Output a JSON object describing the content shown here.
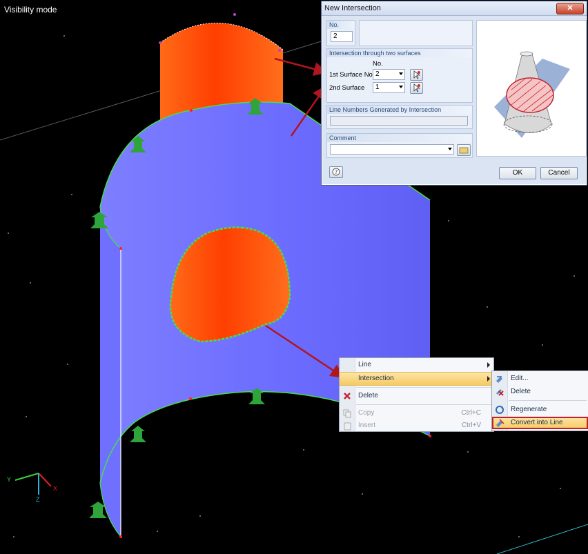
{
  "viewport": {
    "mode_label": "Visibility mode",
    "axis_labels": {
      "y": "Y",
      "x": "X",
      "z": "Z"
    }
  },
  "dialog": {
    "title": "New Intersection",
    "close_label": "✕",
    "no_label": "No.",
    "no_value": "2",
    "section_surfaces": "Intersection through two surfaces",
    "col_no": "No.",
    "first_surface_label": "1st Surface No.:",
    "first_surface_value": "2",
    "second_surface_label": "2nd Surface",
    "second_surface_value": "1",
    "section_lines": "Line Numbers Generated by Intersection",
    "section_comment": "Comment",
    "ok_label": "OK",
    "cancel_label": "Cancel"
  },
  "context_menu": {
    "items": [
      {
        "label": "Line",
        "has_submenu": true
      },
      {
        "label": "Intersection",
        "has_submenu": true,
        "highlighted": true
      },
      {
        "label": "Delete",
        "icon": "delete-icon"
      },
      {
        "label": "Copy",
        "shortcut": "Ctrl+C",
        "disabled": true
      },
      {
        "label": "Insert",
        "shortcut": "Ctrl+V",
        "disabled": true
      }
    ]
  },
  "submenu": {
    "items": [
      {
        "label": "Edit...",
        "icon": "edit-icon"
      },
      {
        "label": "Delete",
        "icon": "delete-icon"
      },
      {
        "label": "Regenerate",
        "icon": "regenerate-icon"
      },
      {
        "label": "Convert into Line",
        "icon": "convert-icon",
        "highlighted": true
      }
    ]
  },
  "colors": {
    "background": "#000000",
    "surface_blue": "#6b6bff",
    "surface_orange": "#ff5a10",
    "support_green": "#2ea43a",
    "edge_green": "#46e04a",
    "arrow_red": "#b0161e",
    "highlight_box": "#c3202d"
  }
}
